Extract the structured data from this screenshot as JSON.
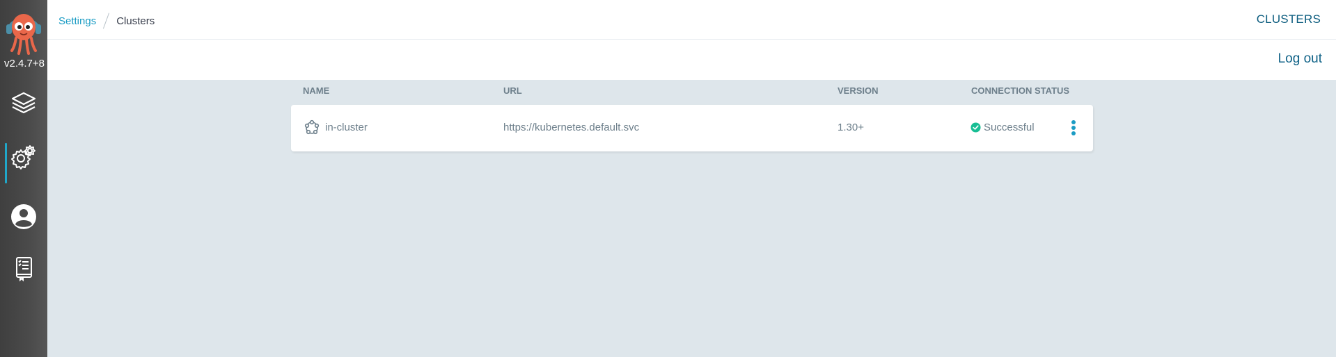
{
  "app": {
    "version": "v2.4.7+8",
    "colors": {
      "sidebar": "#4a4a4a",
      "accent": "#20a7c9",
      "title": "#0d5d7f",
      "success": "#18be94"
    }
  },
  "sidebar": {
    "items": [
      {
        "name": "applications",
        "icon": "layers-icon",
        "active": false
      },
      {
        "name": "settings",
        "icon": "gear-icon",
        "active": true
      },
      {
        "name": "user-info",
        "icon": "user-icon",
        "active": false
      },
      {
        "name": "documentation",
        "icon": "docs-icon",
        "active": false
      }
    ]
  },
  "header": {
    "breadcrumb": {
      "parent": "Settings",
      "current": "Clusters"
    },
    "title": "CLUSTERS"
  },
  "toolbar": {
    "logout_label": "Log out"
  },
  "table": {
    "columns": [
      "NAME",
      "URL",
      "VERSION",
      "CONNECTION STATUS"
    ],
    "rows": [
      {
        "name": "in-cluster",
        "url": "https://kubernetes.default.svc",
        "version": "1.30+",
        "status": "Successful",
        "status_icon": "check-circle-icon"
      }
    ]
  }
}
